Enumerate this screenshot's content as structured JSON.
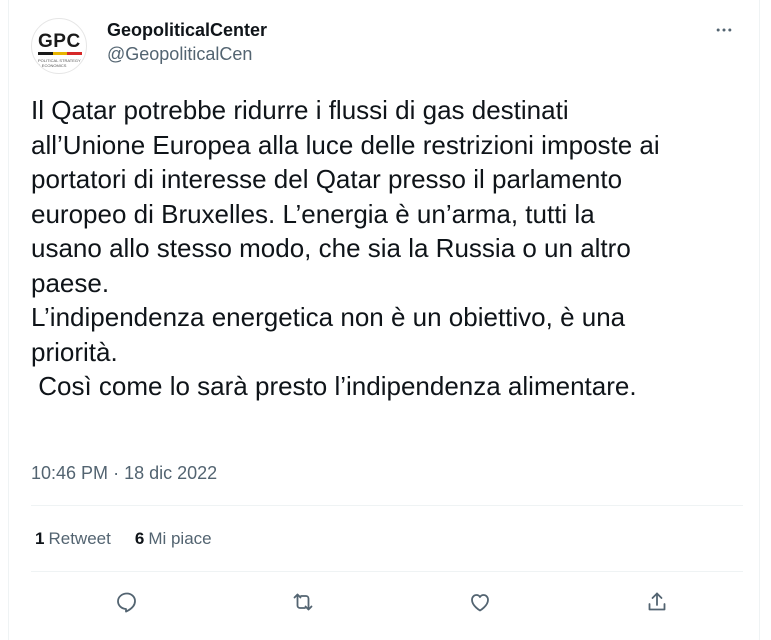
{
  "author": {
    "display_name": "GeopoliticalCenter",
    "handle": "@GeopoliticalCen",
    "avatar_logo": "GPC",
    "avatar_tagline": "POLITICAL STRATEGY & ECONOMICS"
  },
  "more_icon": "more-horizontal-icon",
  "tweet": {
    "text": "Il Qatar potrebbe ridurre i flussi di gas destinati\nall’Unione Europea alla luce delle restrizioni imposte ai\nportatori di interesse del Qatar presso il parlamento\neuropeo di Bruxelles. L’energia è un’arma, tutti la\nusano allo stesso modo, che sia la Russia o un altro\npaese.\nL’indipendenza energetica non è un obiettivo, è una\npriorità.\n Così come lo sarà presto l’indipendenza alimentare.",
    "time": "10:46 PM",
    "separator": "·",
    "date": "18 dic 2022"
  },
  "stats": {
    "retweets_count": "1",
    "retweets_label": "Retweet",
    "likes_count": "6",
    "likes_label": "Mi piace"
  },
  "actions": [
    "reply-icon",
    "retweet-icon",
    "like-icon",
    "share-icon"
  ],
  "colors": {
    "text": "#0f1419",
    "secondary": "#536471",
    "border": "#eff3f4",
    "logo_bar": [
      "#1a1a1a",
      "#e8b400",
      "#d62828"
    ]
  }
}
